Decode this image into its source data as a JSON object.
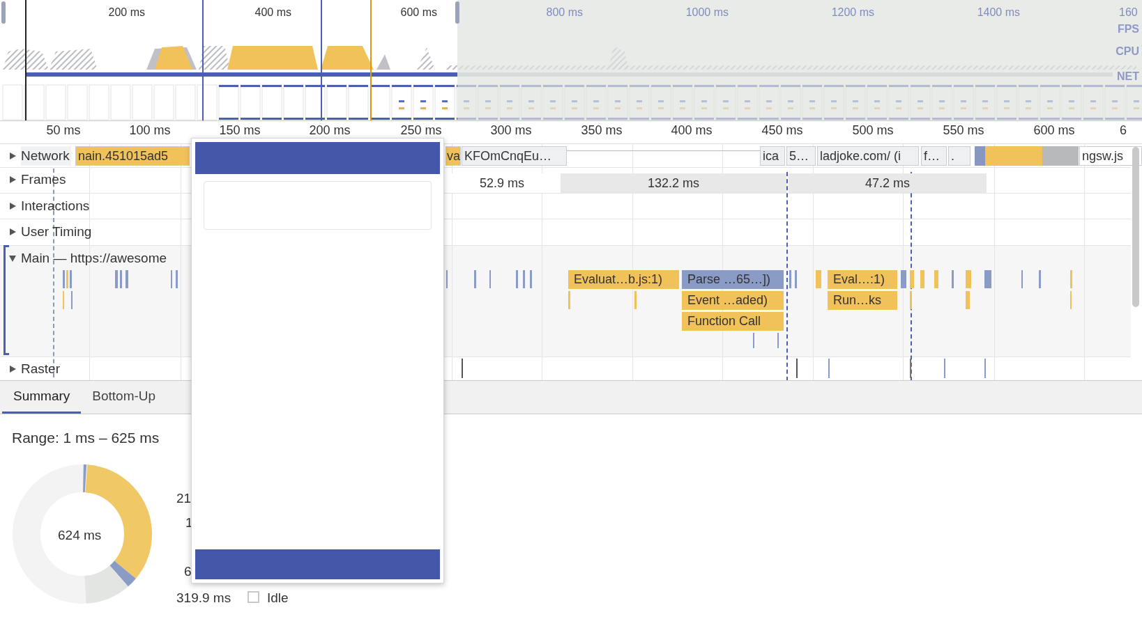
{
  "overview": {
    "ticks": [
      "200 ms",
      "400 ms",
      "600 ms",
      "800 ms",
      "1000 ms",
      "1200 ms",
      "1400 ms",
      "160"
    ],
    "lanes": [
      "FPS",
      "CPU",
      "NET"
    ]
  },
  "ruler": {
    "ticks": [
      "50 ms",
      "100 ms",
      "150 ms",
      "200 ms",
      "250 ms",
      "300 ms",
      "350 ms",
      "400 ms",
      "450 ms",
      "500 ms",
      "550 ms",
      "600 ms",
      "6"
    ]
  },
  "tracks": [
    {
      "label": "Network",
      "expanded": false
    },
    {
      "label": "Frames",
      "expanded": false
    },
    {
      "label": "Interactions",
      "expanded": false
    },
    {
      "label": "User Timing",
      "expanded": false
    },
    {
      "label": "Main — https://awesome",
      "expanded": true
    },
    {
      "label": "Raster",
      "expanded": false
    }
  ],
  "network_requests": [
    {
      "label": "nain.451015ad5",
      "color": "#f1c15a"
    },
    {
      "label": "va",
      "color": "#f1c15a"
    },
    {
      "label": "KFOmCnqEu…",
      "color": "#eef0f2"
    },
    {
      "label": "ica",
      "color": "#eef0f2"
    },
    {
      "label": "5…",
      "color": "#eef0f2"
    },
    {
      "label": "ladjoke.com/ (i",
      "color": "#eef0f2"
    },
    {
      "label": "f…",
      "color": "#eef0f2"
    },
    {
      "label": ".",
      "color": "#eef0f2"
    },
    {
      "label": "ngsw.js",
      "color": "#ffffff"
    }
  ],
  "frames": [
    {
      "label": "52.9 ms",
      "color": "#ffffff"
    },
    {
      "label": "132.2 ms",
      "color": "#e7e8e7"
    },
    {
      "label": "47.2 ms",
      "color": "#e7e8e7"
    }
  ],
  "main_events": [
    {
      "label": "Evaluat…b.js:1)",
      "color": "#f1c15a"
    },
    {
      "label": "Parse …65…])",
      "color": "#8a9bc6"
    },
    {
      "label": "Event …aded)",
      "color": "#f1c15a"
    },
    {
      "label": "Function Call",
      "color": "#f1c15a"
    },
    {
      "label": "Eval…:1)",
      "color": "#f1c15a"
    },
    {
      "label": "Run…ks",
      "color": "#f1c15a"
    }
  ],
  "bottom_tabs": [
    {
      "label": "Summary",
      "selected": true
    },
    {
      "label": "Bottom-Up",
      "selected": false
    }
  ],
  "summary": {
    "range": "Range: 1 ms – 625 ms",
    "total": "624 ms",
    "legend_fragments": [
      "21",
      "1",
      "6"
    ],
    "idle": {
      "value": "319.9 ms",
      "label": "Idle",
      "checked": false
    }
  }
}
